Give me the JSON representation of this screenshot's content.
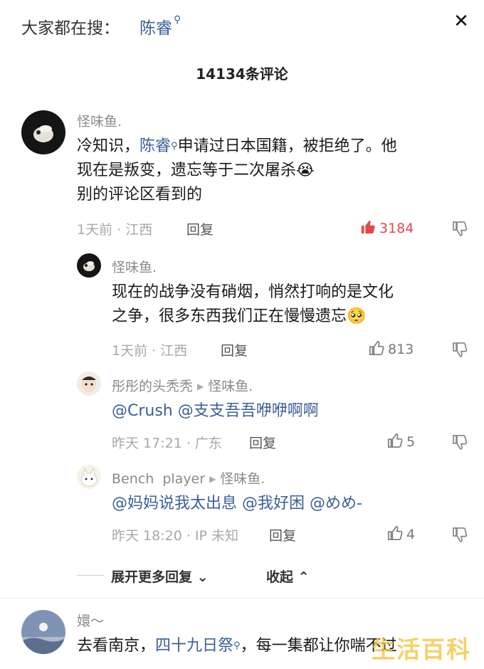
{
  "header": {
    "search_prefix": "大家都在搜：",
    "search_term": "陈睿",
    "close_symbol": "✕"
  },
  "comments_count": "14134条评论",
  "comments": [
    {
      "username": "怪味鱼.",
      "line1_a": "冷知识，",
      "line1_mention": "陈睿",
      "line1_b": "申请过日本国籍，被拒绝了。他",
      "line2": "现在是叛变，遗忘等于二次屠杀",
      "line2_emoji": "😭",
      "line3": "别的评论区看到的",
      "meta": "1天前 · 江西",
      "reply_label": "回复",
      "likes": "3184",
      "liked": true
    },
    {
      "username": "怪味鱼.",
      "line1": "现在的战争没有硝烟，悄然打响的是文化",
      "line2": "之争，很多东西我们正在慢慢遗忘",
      "line2_emoji": "🥺",
      "meta": "1天前 · 江西",
      "reply_label": "回复",
      "likes": "813"
    },
    {
      "username": "彤彤的头秃秃",
      "reply_to": "怪味鱼.",
      "text": "@Crush @支支吾吾咿咿啊啊",
      "meta": "昨天 17:21 · 广东",
      "reply_label": "回复",
      "likes": "5"
    },
    {
      "username": "Bench  player",
      "reply_to": "怪味鱼.",
      "text": "@妈妈说我太出息 @我好困 @めめ-",
      "meta": "昨天 18:20 · IP 未知",
      "reply_label": "回复",
      "likes": "4"
    },
    {
      "username": "嬛～",
      "line1_a": "去看南京，",
      "line1_mention": "四十九日祭",
      "line1_b": "，每一集都让你喘不过"
    }
  ],
  "replies_controls": {
    "expand": "展开更多回复",
    "collapse": "收起"
  },
  "watermark": "生活百科",
  "colors": {
    "link": "#3a5f99",
    "liked": "#e24a4a",
    "meta": "#a8a8a8",
    "watermark": "#f2c232"
  },
  "icons": {
    "search_tag": "search-icon",
    "like": "thumbs-up-icon",
    "dislike": "thumbs-down-icon",
    "close": "close-icon"
  }
}
